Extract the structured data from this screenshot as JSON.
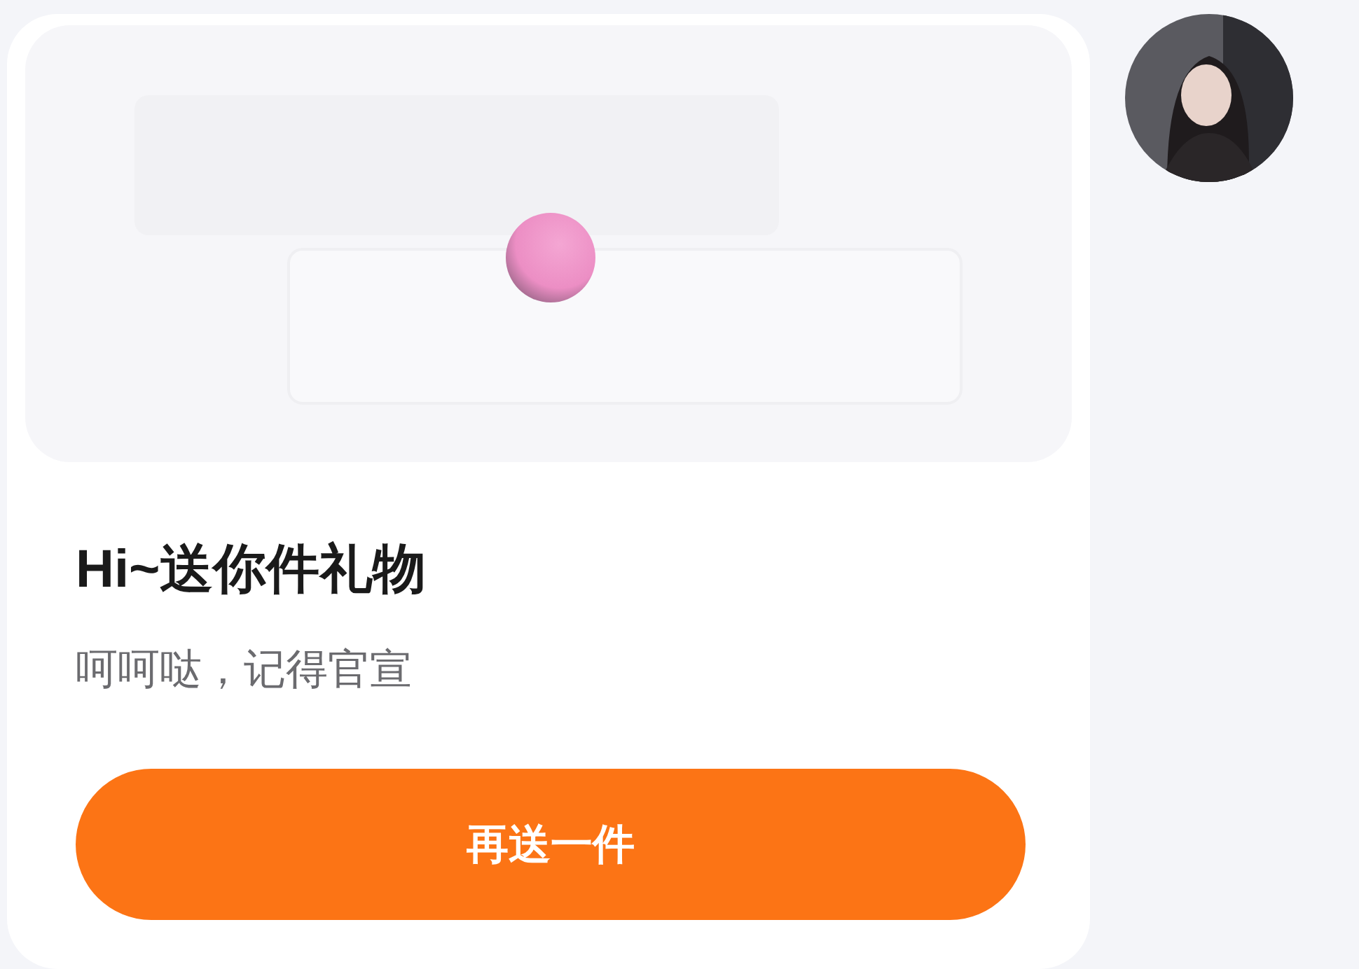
{
  "card": {
    "title": "Hi~送你件礼物",
    "message": "呵呵哒，记得官宣",
    "button": "再送一件"
  },
  "sender": {
    "kind": "avatar"
  }
}
